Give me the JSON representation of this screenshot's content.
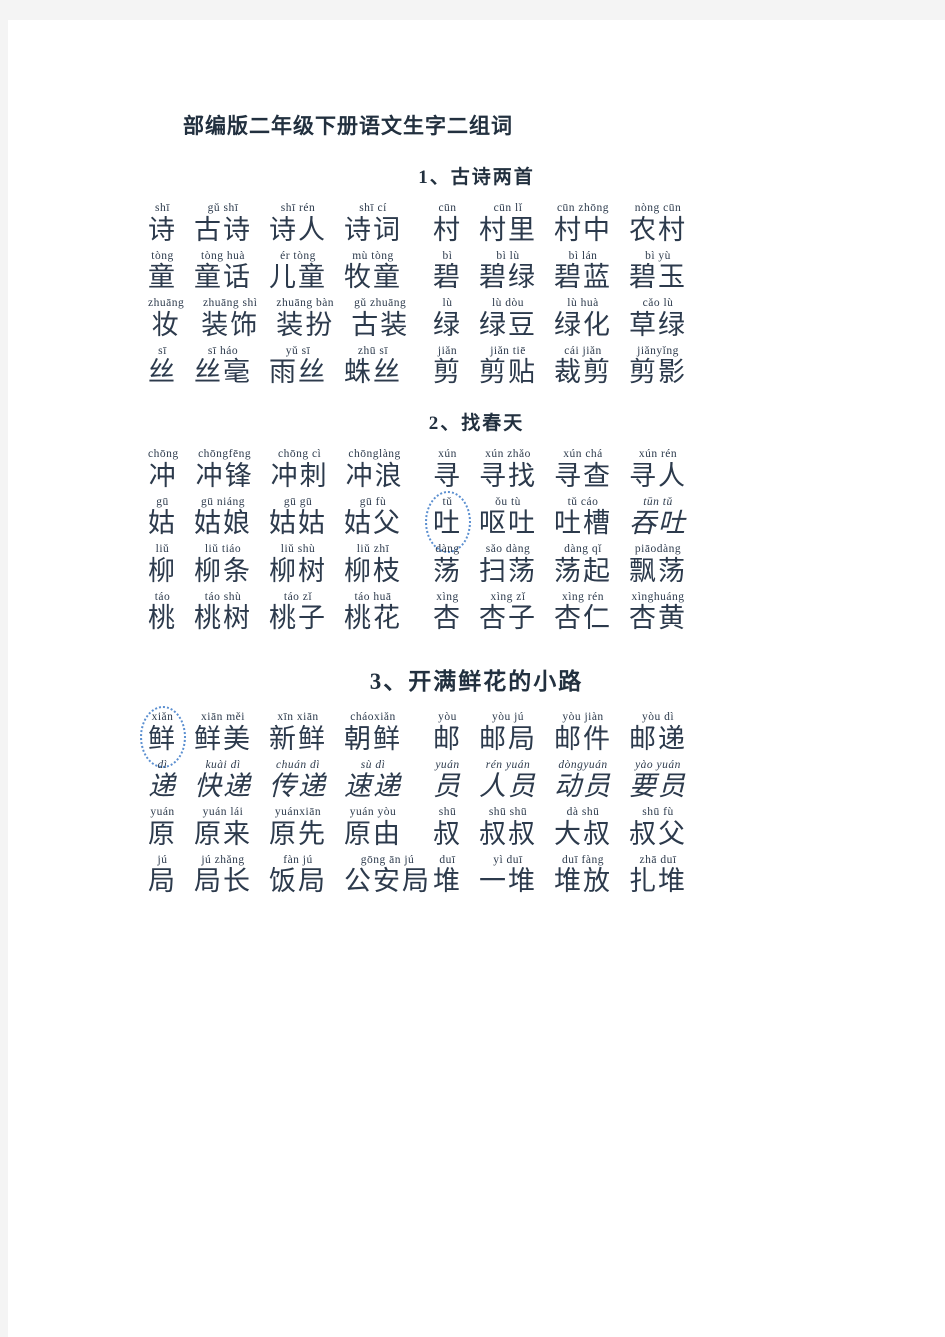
{
  "document": {
    "title": "部编版二年级下册语文生字二组词"
  },
  "theme": {
    "page_background": "#ffffff",
    "outer_background": "#f4f4f4",
    "text_color": "#2c3a4c",
    "annotation_color": "#5b8fd0"
  },
  "sections": [
    {
      "title": "1、古诗两首",
      "title_size": "normal",
      "rows": [
        {
          "left": [
            {
              "pinyin": "shī",
              "hanzi": "诗"
            },
            {
              "pinyin": "gǔ shī",
              "hanzi": "古诗"
            },
            {
              "pinyin": "shī rén",
              "hanzi": "诗人"
            },
            {
              "pinyin": "shī cí",
              "hanzi": "诗词"
            }
          ],
          "right": [
            {
              "pinyin": "cūn",
              "hanzi": "村"
            },
            {
              "pinyin": "cūn lǐ",
              "hanzi": "村里"
            },
            {
              "pinyin": "cūn zhōng",
              "hanzi": "村中"
            },
            {
              "pinyin": "nòng cūn",
              "hanzi": "农村"
            }
          ]
        },
        {
          "left": [
            {
              "pinyin": "tòng",
              "hanzi": "童"
            },
            {
              "pinyin": "tòng huà",
              "hanzi": "童话"
            },
            {
              "pinyin": "ér tòng",
              "hanzi": "儿童"
            },
            {
              "pinyin": "mù tòng",
              "hanzi": "牧童"
            }
          ],
          "right": [
            {
              "pinyin": "bì",
              "hanzi": "碧"
            },
            {
              "pinyin": "bì lù",
              "hanzi": "碧绿"
            },
            {
              "pinyin": "bì lán",
              "hanzi": "碧蓝"
            },
            {
              "pinyin": "bì yù",
              "hanzi": "碧玉"
            }
          ]
        },
        {
          "left": [
            {
              "pinyin": "zhuāng",
              "hanzi": "妆"
            },
            {
              "pinyin": "zhuāng shì",
              "hanzi": "装饰"
            },
            {
              "pinyin": "zhuāng bàn",
              "hanzi": "装扮"
            },
            {
              "pinyin": "gǔ zhuāng",
              "hanzi": "古装"
            }
          ],
          "right": [
            {
              "pinyin": "lù",
              "hanzi": "绿"
            },
            {
              "pinyin": "lù dòu",
              "hanzi": "绿豆"
            },
            {
              "pinyin": "lù huà",
              "hanzi": "绿化"
            },
            {
              "pinyin": "cǎo lù",
              "hanzi": "草绿"
            }
          ]
        },
        {
          "left": [
            {
              "pinyin": "sī",
              "hanzi": "丝"
            },
            {
              "pinyin": "sī háo",
              "hanzi": "丝毫"
            },
            {
              "pinyin": "yǔ sī",
              "hanzi": "雨丝"
            },
            {
              "pinyin": "zhū sī",
              "hanzi": "蛛丝"
            }
          ],
          "right": [
            {
              "pinyin": "jiǎn",
              "hanzi": "剪"
            },
            {
              "pinyin": "jiǎn tiē",
              "hanzi": "剪贴"
            },
            {
              "pinyin": "cái jiǎn",
              "hanzi": "裁剪"
            },
            {
              "pinyin": "jiǎnyǐng",
              "hanzi": "剪影"
            }
          ]
        }
      ]
    },
    {
      "title": "2、找春天",
      "title_size": "normal",
      "rows": [
        {
          "left": [
            {
              "pinyin": "chōng",
              "hanzi": "冲"
            },
            {
              "pinyin": "chōngfēng",
              "hanzi": "冲锋"
            },
            {
              "pinyin": "chōng cì",
              "hanzi": "冲刺"
            },
            {
              "pinyin": "chōnglàng",
              "hanzi": "冲浪"
            }
          ],
          "right": [
            {
              "pinyin": "xún",
              "hanzi": "寻"
            },
            {
              "pinyin": "xún zhǎo",
              "hanzi": "寻找"
            },
            {
              "pinyin": "xún chá",
              "hanzi": "寻查"
            },
            {
              "pinyin": "xún rén",
              "hanzi": "寻人"
            }
          ]
        },
        {
          "left": [
            {
              "pinyin": "gū",
              "hanzi": "姑"
            },
            {
              "pinyin": "gū niáng",
              "hanzi": "姑娘"
            },
            {
              "pinyin": "gū gū",
              "hanzi": "姑姑"
            },
            {
              "pinyin": "gū fù",
              "hanzi": "姑父"
            }
          ],
          "right": [
            {
              "pinyin": "tǔ",
              "hanzi": "吐",
              "circled": true
            },
            {
              "pinyin": "ǒu tù",
              "hanzi": "呕吐"
            },
            {
              "pinyin": "tǔ cáo",
              "hanzi": "吐槽"
            },
            {
              "pinyin": "tūn tǔ",
              "hanzi": "吞吐",
              "italic": true
            }
          ]
        },
        {
          "left": [
            {
              "pinyin": "liǔ",
              "hanzi": "柳"
            },
            {
              "pinyin": "liǔ tiáo",
              "hanzi": "柳条"
            },
            {
              "pinyin": "liǔ shù",
              "hanzi": "柳树"
            },
            {
              "pinyin": "liǔ zhī",
              "hanzi": "柳枝"
            }
          ],
          "right": [
            {
              "pinyin": "dàng",
              "hanzi": "荡"
            },
            {
              "pinyin": "sǎo dàng",
              "hanzi": "扫荡"
            },
            {
              "pinyin": "dàng qǐ",
              "hanzi": "荡起"
            },
            {
              "pinyin": "piāodàng",
              "hanzi": "飘荡"
            }
          ]
        },
        {
          "left": [
            {
              "pinyin": "táo",
              "hanzi": "桃"
            },
            {
              "pinyin": "táo shù",
              "hanzi": "桃树"
            },
            {
              "pinyin": "táo zǐ",
              "hanzi": "桃子"
            },
            {
              "pinyin": "táo huā",
              "hanzi": "桃花"
            }
          ],
          "right": [
            {
              "pinyin": "xìng",
              "hanzi": "杏"
            },
            {
              "pinyin": "xìng zǐ",
              "hanzi": "杏子"
            },
            {
              "pinyin": "xìng rén",
              "hanzi": "杏仁"
            },
            {
              "pinyin": "xìnghuáng",
              "hanzi": "杏黄"
            }
          ]
        }
      ]
    },
    {
      "title": "3、开满鲜花的小路",
      "title_size": "large",
      "rows": [
        {
          "left": [
            {
              "pinyin": "xiǎn",
              "hanzi": "鲜",
              "circled": true
            },
            {
              "pinyin": "xiān měi",
              "hanzi": "鲜美"
            },
            {
              "pinyin": "xīn xiān",
              "hanzi": "新鲜"
            },
            {
              "pinyin": "cháoxiǎn",
              "hanzi": "朝鲜"
            }
          ],
          "right": [
            {
              "pinyin": "yòu",
              "hanzi": "邮"
            },
            {
              "pinyin": "yòu jú",
              "hanzi": "邮局"
            },
            {
              "pinyin": "yòu jiàn",
              "hanzi": "邮件"
            },
            {
              "pinyin": "yòu dì",
              "hanzi": "邮递"
            }
          ]
        },
        {
          "left": [
            {
              "pinyin": "dì",
              "hanzi": "递",
              "italic": true
            },
            {
              "pinyin": "kuài dì",
              "hanzi": "快递",
              "italic": true
            },
            {
              "pinyin": "chuán dì",
              "hanzi": "传递",
              "italic": true
            },
            {
              "pinyin": "sù dì",
              "hanzi": "速递",
              "italic": true
            }
          ],
          "right": [
            {
              "pinyin": "yuán",
              "hanzi": "员",
              "italic": true
            },
            {
              "pinyin": "rén yuán",
              "hanzi": "人员",
              "italic": true
            },
            {
              "pinyin": "dòngyuán",
              "hanzi": "动员",
              "italic": true
            },
            {
              "pinyin": "yào yuán",
              "hanzi": "要员",
              "italic": true
            }
          ]
        },
        {
          "left": [
            {
              "pinyin": "yuán",
              "hanzi": "原"
            },
            {
              "pinyin": "yuán lái",
              "hanzi": "原来"
            },
            {
              "pinyin": "yuánxiān",
              "hanzi": "原先"
            },
            {
              "pinyin": "yuán yòu",
              "hanzi": "原由"
            }
          ],
          "right": [
            {
              "pinyin": "shū",
              "hanzi": "叔"
            },
            {
              "pinyin": "shū shū",
              "hanzi": "叔叔"
            },
            {
              "pinyin": "dà shū",
              "hanzi": "大叔"
            },
            {
              "pinyin": "shū fù",
              "hanzi": "叔父"
            }
          ]
        },
        {
          "left": [
            {
              "pinyin": "jú",
              "hanzi": "局"
            },
            {
              "pinyin": "jú zhǎng",
              "hanzi": "局长"
            },
            {
              "pinyin": "fàn jú",
              "hanzi": "饭局"
            },
            {
              "pinyin": "gōng ān jú",
              "hanzi": "公安局"
            }
          ],
          "right": [
            {
              "pinyin": "duī",
              "hanzi": "堆"
            },
            {
              "pinyin": "yì duī",
              "hanzi": "一堆"
            },
            {
              "pinyin": "duī fàng",
              "hanzi": "堆放"
            },
            {
              "pinyin": "zhā duī",
              "hanzi": "扎堆"
            }
          ]
        }
      ]
    }
  ]
}
